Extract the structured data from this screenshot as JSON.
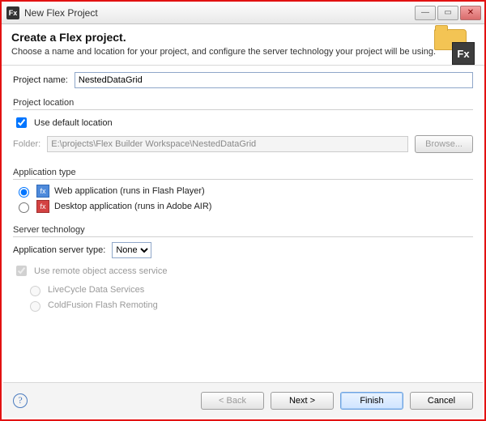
{
  "window": {
    "title": "New Flex Project"
  },
  "header": {
    "heading": "Create a Flex project.",
    "description": "Choose a name and location for your project, and configure the server technology your project will be using."
  },
  "fields": {
    "projectName": {
      "label": "Project name:",
      "value": "NestedDataGrid"
    }
  },
  "groups": {
    "location": {
      "title": "Project location",
      "useDefault": "Use default location",
      "folderLabel": "Folder:",
      "folderValue": "E:\\projects\\Flex Builder Workspace\\NestedDataGrid",
      "browse": "Browse..."
    },
    "appType": {
      "title": "Application type",
      "web": "Web application (runs in Flash Player)",
      "desktop": "Desktop application (runs in Adobe AIR)"
    },
    "server": {
      "title": "Server technology",
      "typeLabel": "Application server type:",
      "typeValue": "None",
      "remoteObject": "Use remote object access service",
      "lcds": "LiveCycle Data Services",
      "cf": "ColdFusion Flash Remoting"
    }
  },
  "footer": {
    "back": "< Back",
    "next": "Next >",
    "finish": "Finish",
    "cancel": "Cancel"
  }
}
